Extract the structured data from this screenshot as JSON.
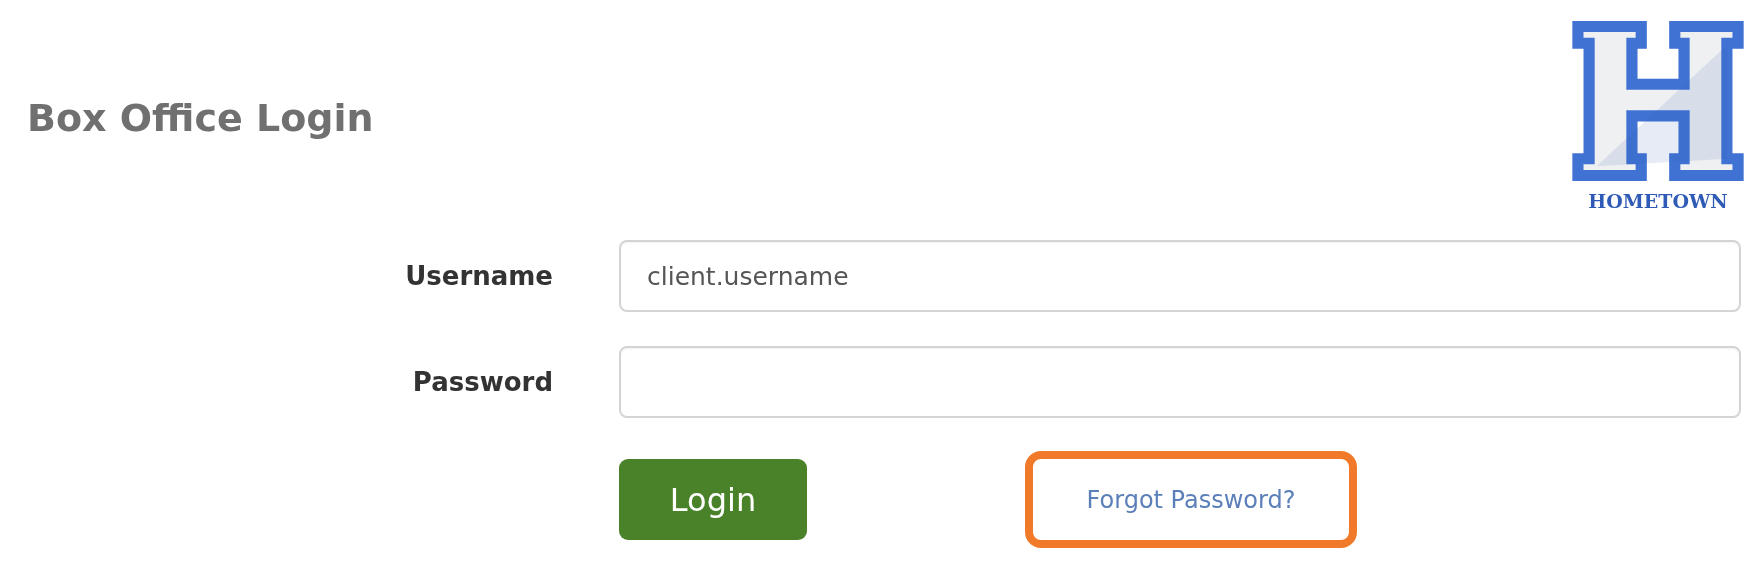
{
  "header": {
    "title": "Box Office Login",
    "logo": {
      "wordmark": "HOMETOWN"
    }
  },
  "form": {
    "fields": [
      {
        "label": "Username",
        "value": "client.username",
        "kind": "text"
      },
      {
        "label": "Password",
        "kind": "password"
      }
    ],
    "submit": "Login",
    "forgot_link": {
      "text": "Forgot Password?",
      "highlighted": true
    }
  }
}
